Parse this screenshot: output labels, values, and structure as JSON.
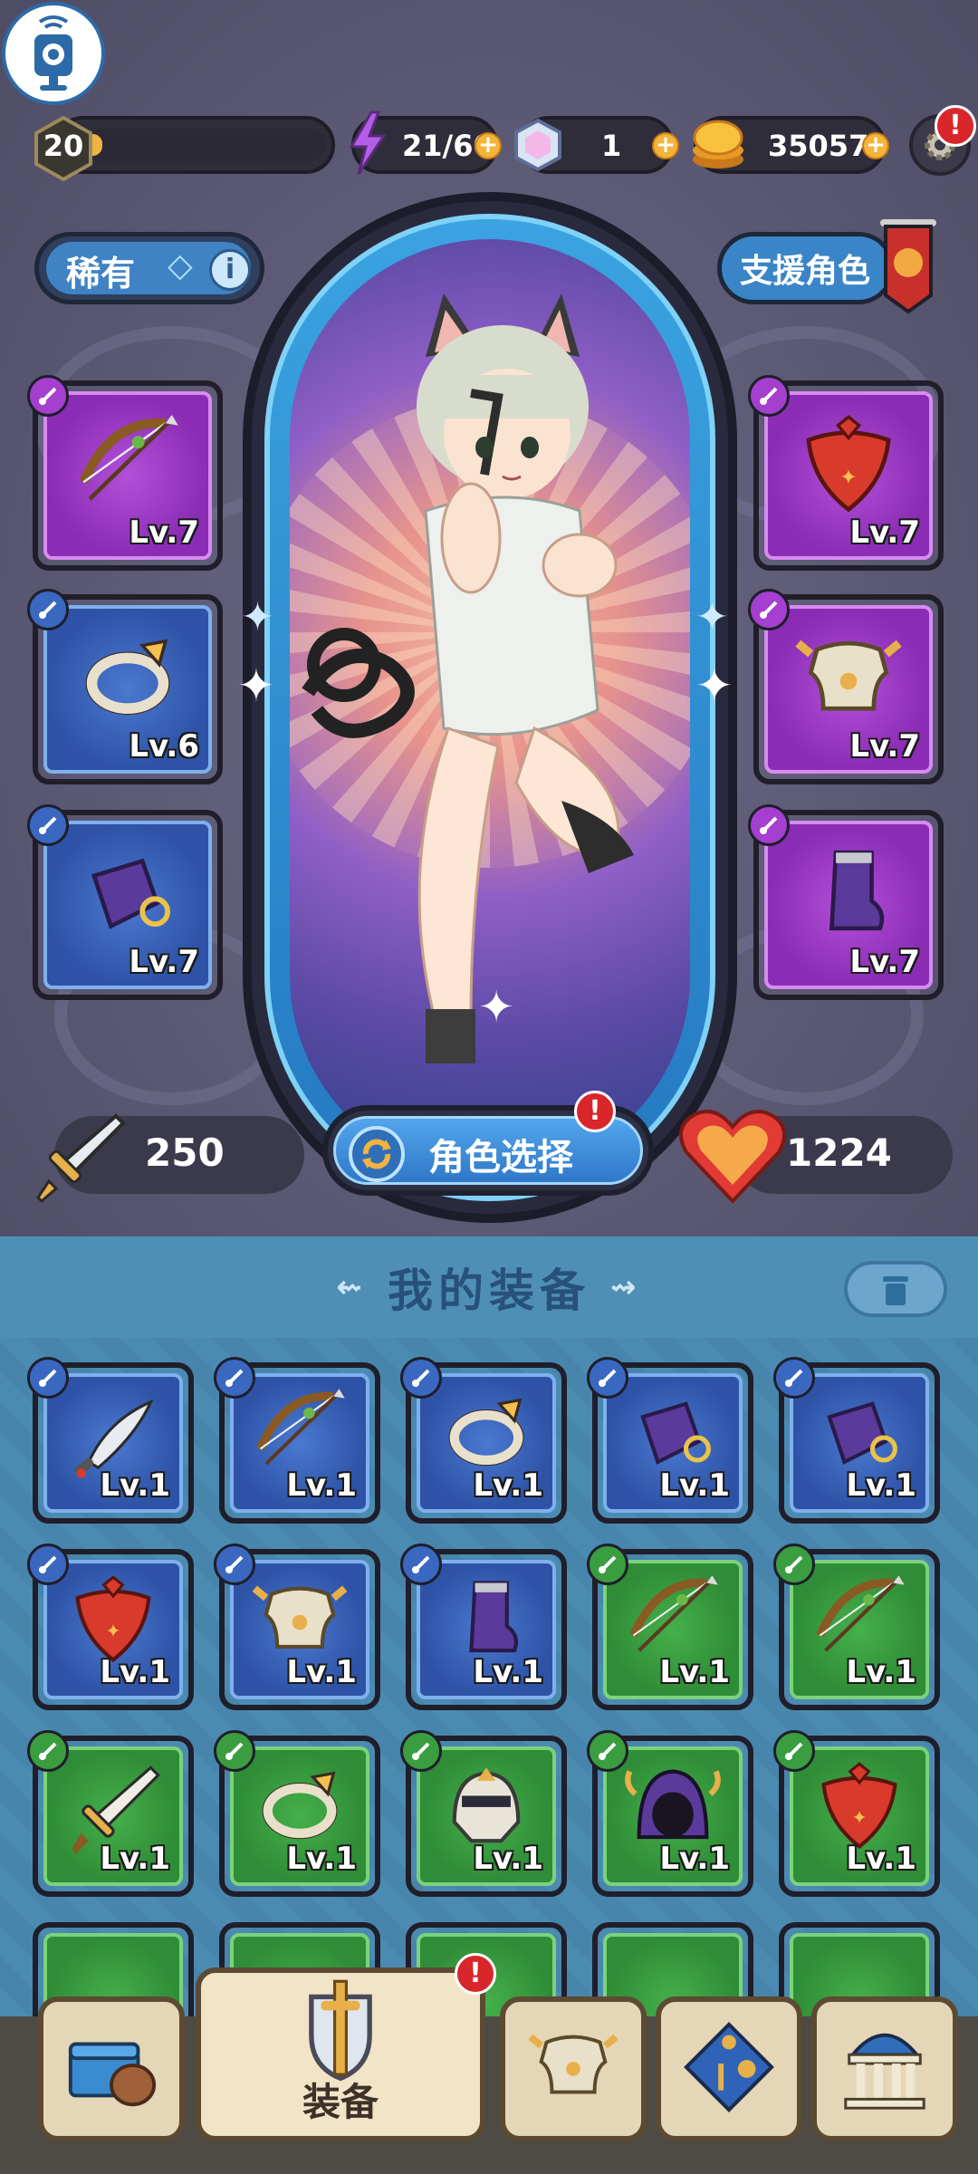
{
  "status": {
    "level": "20",
    "xp_progress": 0.08,
    "energy": "21/60",
    "gems": "1",
    "coins": "35057",
    "settings_alert": "!"
  },
  "rarity": {
    "label": "稀有"
  },
  "support": {
    "label": "支援角色"
  },
  "equipped": {
    "left": [
      {
        "icon": "bow-icon",
        "level": "Lv.7",
        "rarity": "purple",
        "slot_type": "weapon"
      },
      {
        "icon": "ring-icon",
        "level": "Lv.6",
        "rarity": "blue",
        "slot_type": "ring"
      },
      {
        "icon": "bracer-icon",
        "level": "Lv.7",
        "rarity": "blue",
        "slot_type": "accessory"
      }
    ],
    "right": [
      {
        "icon": "scarf-icon",
        "level": "Lv.7",
        "rarity": "purple",
        "slot_type": "neck"
      },
      {
        "icon": "armor-icon",
        "level": "Lv.7",
        "rarity": "purple",
        "slot_type": "armor"
      },
      {
        "icon": "boots-icon",
        "level": "Lv.7",
        "rarity": "purple",
        "slot_type": "boots"
      }
    ]
  },
  "stats": {
    "attack": "250",
    "health": "1224",
    "select_label": "角色选择",
    "select_alert": "!"
  },
  "inventory": {
    "title": "我的装备",
    "items": [
      {
        "icon": "dagger-icon",
        "level": "Lv.1",
        "rarity": "blue"
      },
      {
        "icon": "bow-icon",
        "level": "Lv.1",
        "rarity": "blue"
      },
      {
        "icon": "ring-icon",
        "level": "Lv.1",
        "rarity": "blue"
      },
      {
        "icon": "bracer-icon",
        "level": "Lv.1",
        "rarity": "blue"
      },
      {
        "icon": "bracer-icon",
        "level": "Lv.1",
        "rarity": "blue"
      },
      {
        "icon": "scarf-icon",
        "level": "Lv.1",
        "rarity": "blue"
      },
      {
        "icon": "armor-icon",
        "level": "Lv.1",
        "rarity": "blue"
      },
      {
        "icon": "boots-icon",
        "level": "Lv.1",
        "rarity": "blue"
      },
      {
        "icon": "bow-icon",
        "level": "Lv.1",
        "rarity": "green"
      },
      {
        "icon": "bow-icon",
        "level": "Lv.1",
        "rarity": "green"
      },
      {
        "icon": "sword-icon",
        "level": "Lv.1",
        "rarity": "green"
      },
      {
        "icon": "ring-icon",
        "level": "Lv.1",
        "rarity": "green"
      },
      {
        "icon": "helmet-icon",
        "level": "Lv.1",
        "rarity": "green"
      },
      {
        "icon": "hood-icon",
        "level": "Lv.1",
        "rarity": "green"
      },
      {
        "icon": "scarf-icon",
        "level": "Lv.1",
        "rarity": "green"
      }
    ]
  },
  "nav": {
    "items": [
      {
        "icon": "chest-icon",
        "label": ""
      },
      {
        "icon": "sword-shield-icon",
        "label": "装备"
      },
      {
        "icon": "armor-icon",
        "label": ""
      },
      {
        "icon": "skill-tree-icon",
        "label": ""
      },
      {
        "icon": "temple-icon",
        "label": ""
      }
    ],
    "equip_alert": "!"
  },
  "colors": {
    "purple_rarity": "#8a2db4",
    "blue_rarity": "#2e53a6",
    "green_rarity": "#2f8c37",
    "accent_blue": "#3a85c7",
    "gold": "#f0b343"
  }
}
